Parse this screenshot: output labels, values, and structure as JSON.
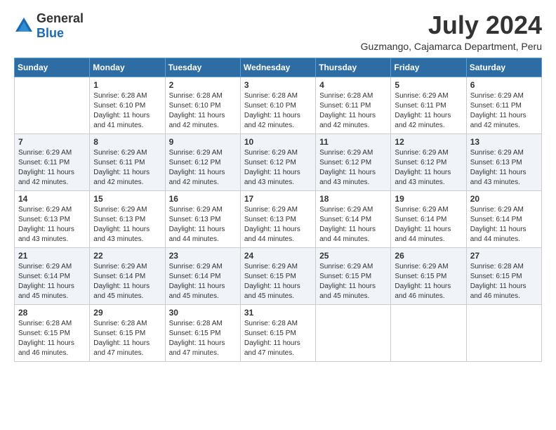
{
  "logo": {
    "general": "General",
    "blue": "Blue"
  },
  "title": "July 2024",
  "location": "Guzmango, Cajamarca Department, Peru",
  "days_of_week": [
    "Sunday",
    "Monday",
    "Tuesday",
    "Wednesday",
    "Thursday",
    "Friday",
    "Saturday"
  ],
  "weeks": [
    [
      {
        "day": "",
        "sunrise": "",
        "sunset": "",
        "daylight": ""
      },
      {
        "day": "1",
        "sunrise": "Sunrise: 6:28 AM",
        "sunset": "Sunset: 6:10 PM",
        "daylight": "Daylight: 11 hours and 41 minutes."
      },
      {
        "day": "2",
        "sunrise": "Sunrise: 6:28 AM",
        "sunset": "Sunset: 6:10 PM",
        "daylight": "Daylight: 11 hours and 42 minutes."
      },
      {
        "day": "3",
        "sunrise": "Sunrise: 6:28 AM",
        "sunset": "Sunset: 6:10 PM",
        "daylight": "Daylight: 11 hours and 42 minutes."
      },
      {
        "day": "4",
        "sunrise": "Sunrise: 6:28 AM",
        "sunset": "Sunset: 6:11 PM",
        "daylight": "Daylight: 11 hours and 42 minutes."
      },
      {
        "day": "5",
        "sunrise": "Sunrise: 6:29 AM",
        "sunset": "Sunset: 6:11 PM",
        "daylight": "Daylight: 11 hours and 42 minutes."
      },
      {
        "day": "6",
        "sunrise": "Sunrise: 6:29 AM",
        "sunset": "Sunset: 6:11 PM",
        "daylight": "Daylight: 11 hours and 42 minutes."
      }
    ],
    [
      {
        "day": "7",
        "sunrise": "Sunrise: 6:29 AM",
        "sunset": "Sunset: 6:11 PM",
        "daylight": "Daylight: 11 hours and 42 minutes."
      },
      {
        "day": "8",
        "sunrise": "Sunrise: 6:29 AM",
        "sunset": "Sunset: 6:11 PM",
        "daylight": "Daylight: 11 hours and 42 minutes."
      },
      {
        "day": "9",
        "sunrise": "Sunrise: 6:29 AM",
        "sunset": "Sunset: 6:12 PM",
        "daylight": "Daylight: 11 hours and 42 minutes."
      },
      {
        "day": "10",
        "sunrise": "Sunrise: 6:29 AM",
        "sunset": "Sunset: 6:12 PM",
        "daylight": "Daylight: 11 hours and 43 minutes."
      },
      {
        "day": "11",
        "sunrise": "Sunrise: 6:29 AM",
        "sunset": "Sunset: 6:12 PM",
        "daylight": "Daylight: 11 hours and 43 minutes."
      },
      {
        "day": "12",
        "sunrise": "Sunrise: 6:29 AM",
        "sunset": "Sunset: 6:12 PM",
        "daylight": "Daylight: 11 hours and 43 minutes."
      },
      {
        "day": "13",
        "sunrise": "Sunrise: 6:29 AM",
        "sunset": "Sunset: 6:13 PM",
        "daylight": "Daylight: 11 hours and 43 minutes."
      }
    ],
    [
      {
        "day": "14",
        "sunrise": "Sunrise: 6:29 AM",
        "sunset": "Sunset: 6:13 PM",
        "daylight": "Daylight: 11 hours and 43 minutes."
      },
      {
        "day": "15",
        "sunrise": "Sunrise: 6:29 AM",
        "sunset": "Sunset: 6:13 PM",
        "daylight": "Daylight: 11 hours and 43 minutes."
      },
      {
        "day": "16",
        "sunrise": "Sunrise: 6:29 AM",
        "sunset": "Sunset: 6:13 PM",
        "daylight": "Daylight: 11 hours and 44 minutes."
      },
      {
        "day": "17",
        "sunrise": "Sunrise: 6:29 AM",
        "sunset": "Sunset: 6:13 PM",
        "daylight": "Daylight: 11 hours and 44 minutes."
      },
      {
        "day": "18",
        "sunrise": "Sunrise: 6:29 AM",
        "sunset": "Sunset: 6:14 PM",
        "daylight": "Daylight: 11 hours and 44 minutes."
      },
      {
        "day": "19",
        "sunrise": "Sunrise: 6:29 AM",
        "sunset": "Sunset: 6:14 PM",
        "daylight": "Daylight: 11 hours and 44 minutes."
      },
      {
        "day": "20",
        "sunrise": "Sunrise: 6:29 AM",
        "sunset": "Sunset: 6:14 PM",
        "daylight": "Daylight: 11 hours and 44 minutes."
      }
    ],
    [
      {
        "day": "21",
        "sunrise": "Sunrise: 6:29 AM",
        "sunset": "Sunset: 6:14 PM",
        "daylight": "Daylight: 11 hours and 45 minutes."
      },
      {
        "day": "22",
        "sunrise": "Sunrise: 6:29 AM",
        "sunset": "Sunset: 6:14 PM",
        "daylight": "Daylight: 11 hours and 45 minutes."
      },
      {
        "day": "23",
        "sunrise": "Sunrise: 6:29 AM",
        "sunset": "Sunset: 6:14 PM",
        "daylight": "Daylight: 11 hours and 45 minutes."
      },
      {
        "day": "24",
        "sunrise": "Sunrise: 6:29 AM",
        "sunset": "Sunset: 6:15 PM",
        "daylight": "Daylight: 11 hours and 45 minutes."
      },
      {
        "day": "25",
        "sunrise": "Sunrise: 6:29 AM",
        "sunset": "Sunset: 6:15 PM",
        "daylight": "Daylight: 11 hours and 45 minutes."
      },
      {
        "day": "26",
        "sunrise": "Sunrise: 6:29 AM",
        "sunset": "Sunset: 6:15 PM",
        "daylight": "Daylight: 11 hours and 46 minutes."
      },
      {
        "day": "27",
        "sunrise": "Sunrise: 6:28 AM",
        "sunset": "Sunset: 6:15 PM",
        "daylight": "Daylight: 11 hours and 46 minutes."
      }
    ],
    [
      {
        "day": "28",
        "sunrise": "Sunrise: 6:28 AM",
        "sunset": "Sunset: 6:15 PM",
        "daylight": "Daylight: 11 hours and 46 minutes."
      },
      {
        "day": "29",
        "sunrise": "Sunrise: 6:28 AM",
        "sunset": "Sunset: 6:15 PM",
        "daylight": "Daylight: 11 hours and 47 minutes."
      },
      {
        "day": "30",
        "sunrise": "Sunrise: 6:28 AM",
        "sunset": "Sunset: 6:15 PM",
        "daylight": "Daylight: 11 hours and 47 minutes."
      },
      {
        "day": "31",
        "sunrise": "Sunrise: 6:28 AM",
        "sunset": "Sunset: 6:15 PM",
        "daylight": "Daylight: 11 hours and 47 minutes."
      },
      {
        "day": "",
        "sunrise": "",
        "sunset": "",
        "daylight": ""
      },
      {
        "day": "",
        "sunrise": "",
        "sunset": "",
        "daylight": ""
      },
      {
        "day": "",
        "sunrise": "",
        "sunset": "",
        "daylight": ""
      }
    ]
  ]
}
